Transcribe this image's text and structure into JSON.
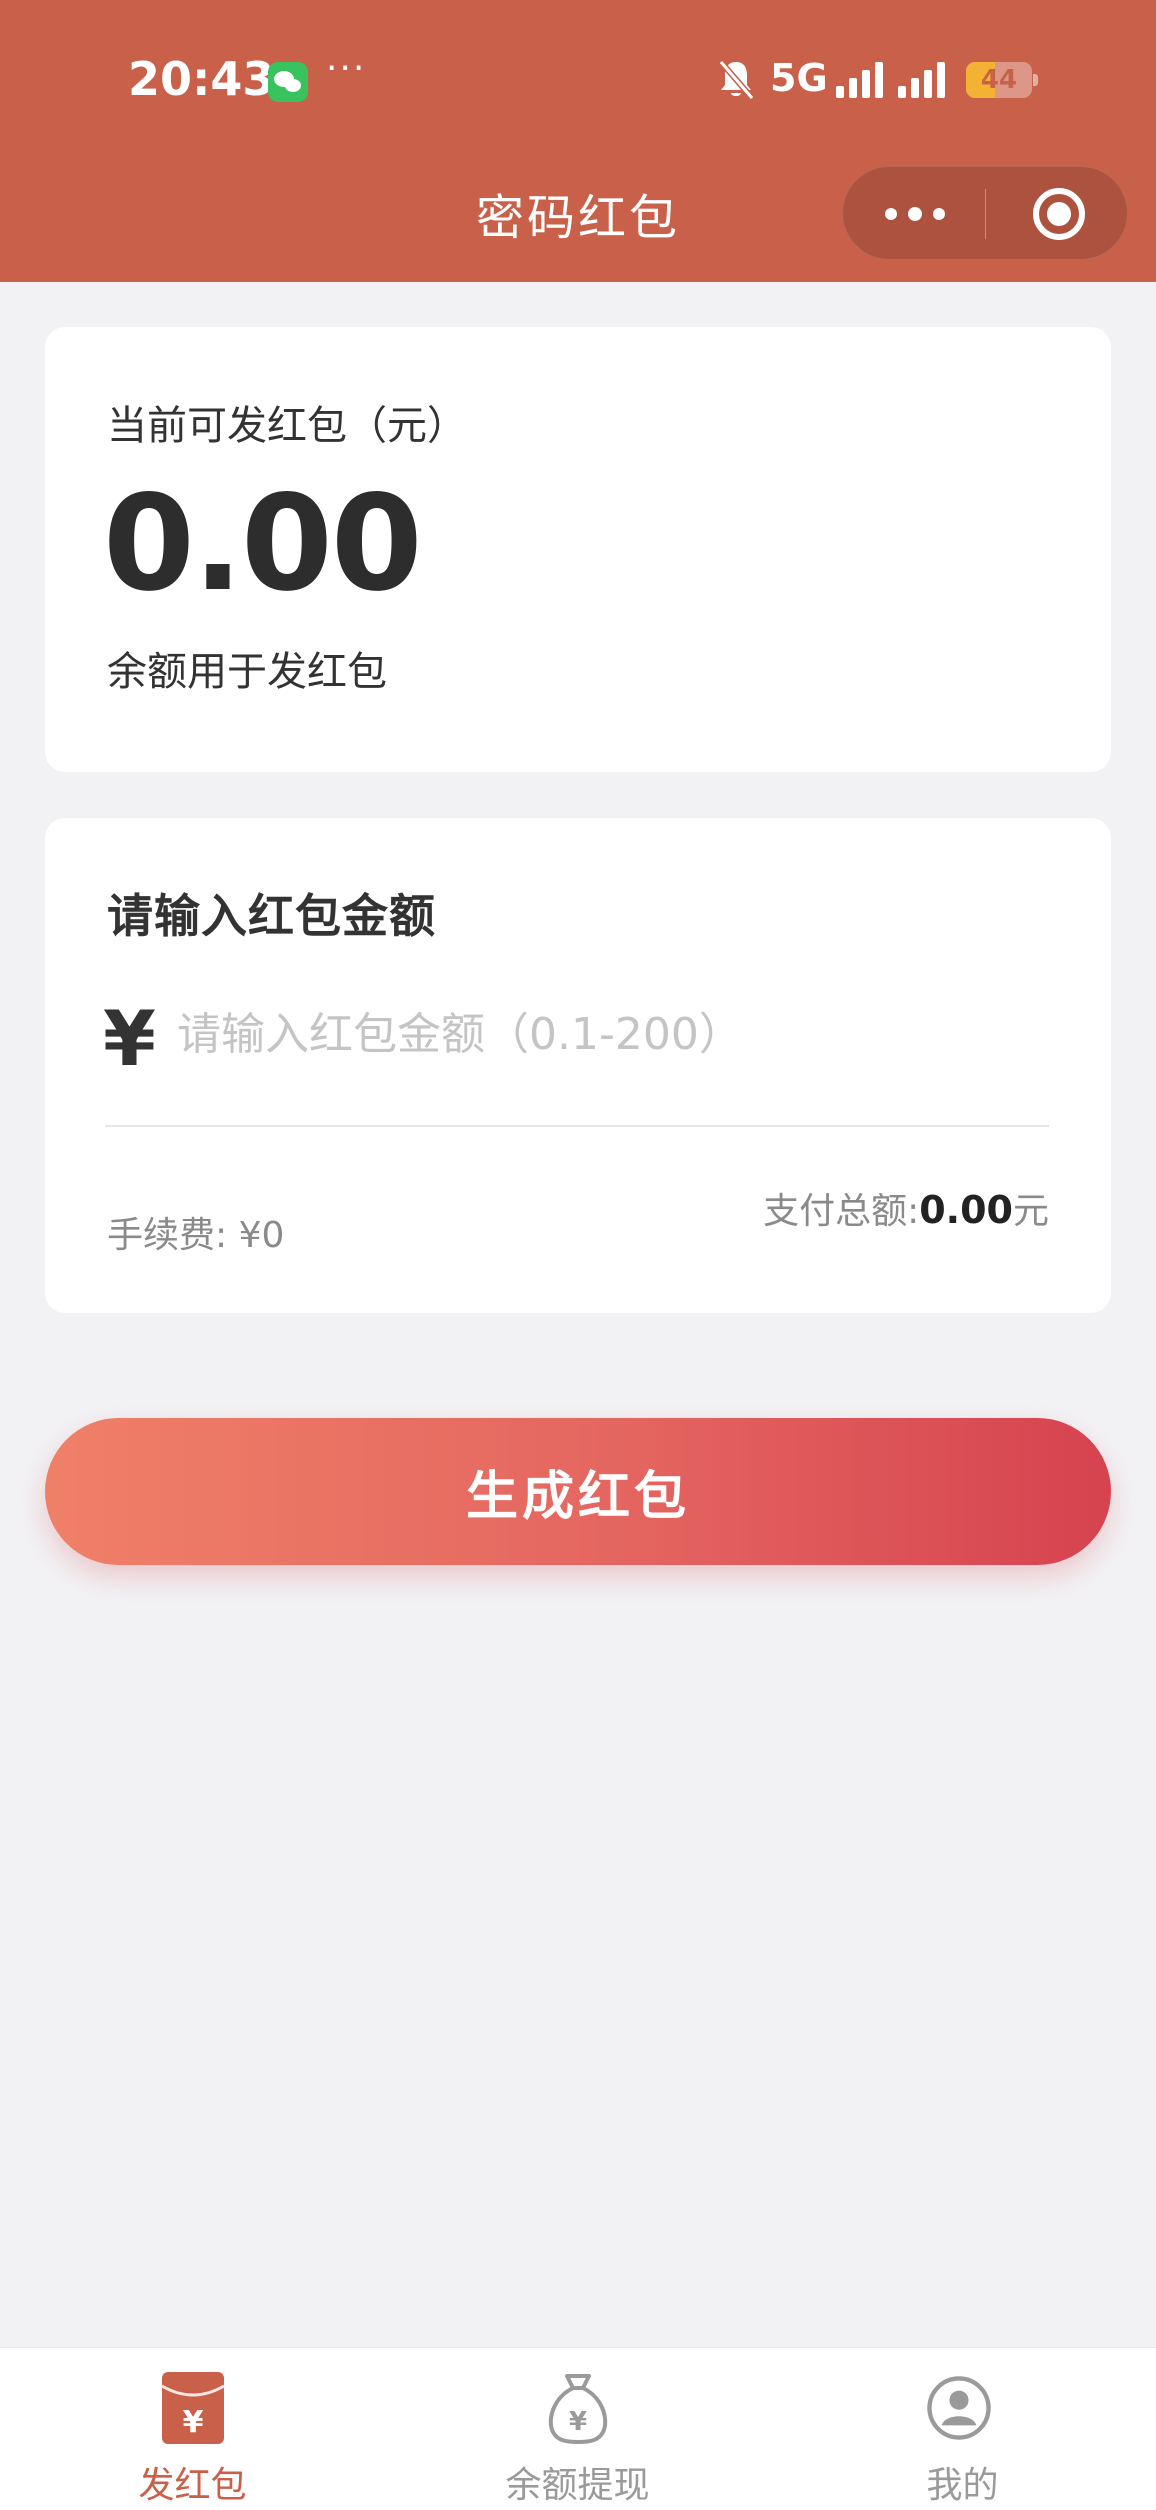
{
  "status_bar": {
    "time": "20:43",
    "dots": "···",
    "network": "5G",
    "battery": "44",
    "battery_level": 0.44,
    "icons": [
      "wechat-icon",
      "bell-off-icon",
      "signal-icon",
      "battery-icon"
    ]
  },
  "header": {
    "title": "密码红包",
    "capsule_icons": [
      "more-icon",
      "close-miniprogram-icon"
    ],
    "color": "#c9604a"
  },
  "balance_card": {
    "label": "当前可发红包（元）",
    "value": "0.00",
    "note": "余额用于发红包"
  },
  "amount_card": {
    "title": "请输入红包金额",
    "currency_symbol": "¥",
    "input_value": "",
    "input_placeholder": "请输入红包金额（0.1-200）",
    "fee_text": "手续费: ¥0",
    "total_label": "支付总额:",
    "total_value": "0.00",
    "total_unit": "元"
  },
  "generate_button": {
    "label": "生成红包",
    "gradient": [
      "#ef8068",
      "#d6434f"
    ]
  },
  "tabbar": {
    "active_color": "#c9604a",
    "inactive_color": "#9a9a9a",
    "tabs": [
      {
        "label": "发红包",
        "icon": "red-envelope-icon",
        "active": true
      },
      {
        "label": "余额提现",
        "icon": "money-bag-icon",
        "active": false
      },
      {
        "label": "我的",
        "icon": "user-icon",
        "active": false
      }
    ]
  }
}
